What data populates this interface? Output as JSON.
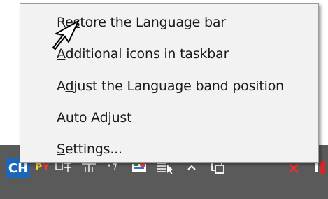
{
  "taskbar": {
    "language_code": "CH",
    "ime_mode_left": "P",
    "ime_mode_right": "Y",
    "icons": [
      {
        "name": "ime-pinyin-icon"
      },
      {
        "name": "full-half-width-icon"
      },
      {
        "name": "punctuation-icon"
      },
      {
        "name": "soft-keyboard-icon"
      },
      {
        "name": "ime-settings-icon"
      },
      {
        "name": "ime-menu-icon"
      },
      {
        "name": "show-hidden-icons-chevron"
      },
      {
        "name": "network-icon"
      },
      {
        "name": "close-x-icon"
      },
      {
        "name": "volume-icon"
      }
    ]
  },
  "menu": {
    "items": [
      {
        "label": "Restore the Language bar",
        "accel_before": "Re",
        "accel": "s",
        "accel_after": "tore the Language bar"
      },
      {
        "label": "Additional icons in taskbar",
        "accel_before": "",
        "accel": "A",
        "accel_after": "dditional icons in taskbar"
      },
      {
        "label": "Adjust the Language band position",
        "accel_before": "A",
        "accel": "d",
        "accel_after": "just the Language band position"
      },
      {
        "label": "Auto Adjust",
        "accel_before": "A",
        "accel": "u",
        "accel_after": "to Adjust"
      },
      {
        "label": "Settings...",
        "accel_before": "",
        "accel": "S",
        "accel_after": "ettings..."
      }
    ]
  }
}
